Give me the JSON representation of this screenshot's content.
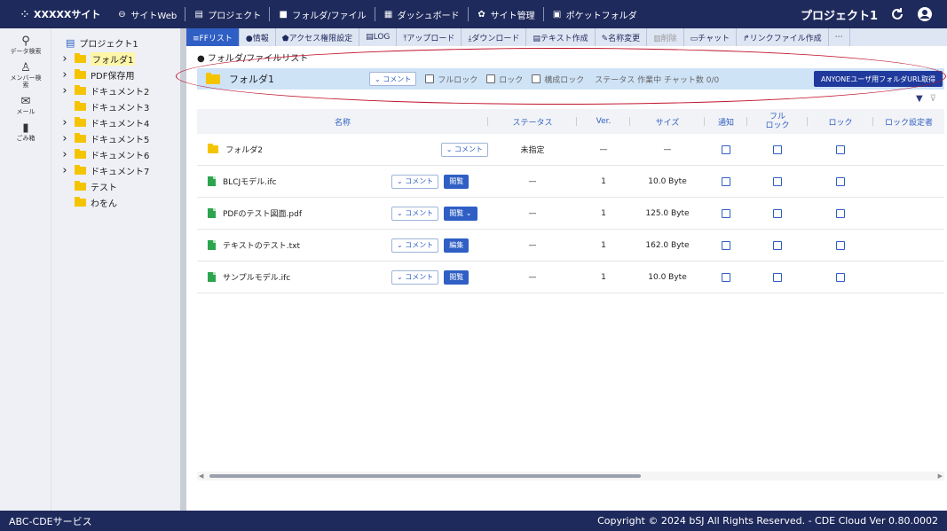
{
  "topbar": {
    "brand": "XXXXXサイト",
    "items": [
      {
        "icon": "link-icon",
        "glyph": "⊖",
        "label": "サイトWeb"
      },
      {
        "icon": "project-icon",
        "glyph": "▤",
        "label": "プロジェクト"
      },
      {
        "icon": "folder-icon",
        "glyph": "■",
        "label": "フォルダ/ファイル"
      },
      {
        "icon": "dashboard-icon",
        "glyph": "▦",
        "label": "ダッシュボード"
      },
      {
        "icon": "gear-icon",
        "glyph": "✿",
        "label": "サイト管理"
      },
      {
        "icon": "pocket-folder-icon",
        "glyph": "▣",
        "label": "ポケットフォルダ"
      }
    ],
    "project_name": "プロジェクト1"
  },
  "rail": [
    {
      "icon": "data-search-icon",
      "glyph": "⚲",
      "label": "データ検索"
    },
    {
      "icon": "member-search-icon",
      "glyph": "♙",
      "label": "メンバー検索"
    },
    {
      "icon": "mail-icon",
      "glyph": "✉",
      "label": "メール"
    },
    {
      "icon": "trash-icon",
      "glyph": "▮",
      "label": "ごみ箱"
    }
  ],
  "tree": {
    "root": "プロジェクト1",
    "nodes": [
      {
        "label": "フォルダ1",
        "chevron": true,
        "selected": true
      },
      {
        "label": "PDF保存用",
        "chevron": true,
        "selected": false
      },
      {
        "label": "ドキュメント2",
        "chevron": true,
        "selected": false
      },
      {
        "label": "ドキュメント3",
        "chevron": false,
        "selected": false
      },
      {
        "label": "ドキュメント4",
        "chevron": true,
        "selected": false
      },
      {
        "label": "ドキュメント5",
        "chevron": true,
        "selected": false
      },
      {
        "label": "ドキュメント6",
        "chevron": true,
        "selected": false
      },
      {
        "label": "ドキュメント7",
        "chevron": true,
        "selected": false
      },
      {
        "label": "テスト",
        "chevron": false,
        "selected": false
      },
      {
        "label": "わをん",
        "chevron": false,
        "selected": false
      }
    ]
  },
  "toolbar": [
    {
      "label": "≡FFリスト",
      "state": "active"
    },
    {
      "label": "●情報",
      "state": "normal"
    },
    {
      "label": "⬟アクセス権限設定",
      "state": "normal"
    },
    {
      "label": "▤LOG",
      "state": "normal"
    },
    {
      "label": "⤒アップロード",
      "state": "normal"
    },
    {
      "label": "⤓ダウンロード",
      "state": "normal"
    },
    {
      "label": "▤テキスト作成",
      "state": "normal"
    },
    {
      "label": "✎名称変更",
      "state": "normal"
    },
    {
      "label": "▥削除",
      "state": "disabled"
    },
    {
      "label": "▭チャット",
      "state": "normal"
    },
    {
      "label": "↱リンクファイル作成",
      "state": "normal"
    },
    {
      "label": "⋯",
      "state": "normal"
    }
  ],
  "breadcrumb": "● フォルダ/ファイルリスト",
  "folderbar": {
    "name": "フォルダ1",
    "comment": "⌄ コメント",
    "options": [
      "フルロック",
      "ロック",
      "構成ロック"
    ],
    "status": "ステータス 作業中  チャット数 0/0",
    "anyone_button": "ANYONEユーザ用フォルダURL取得"
  },
  "filters": {
    "funnel": "▼",
    "clear": "⊽"
  },
  "table": {
    "headers": {
      "name": "名称",
      "status": "ステータス",
      "ver": "Ver.",
      "size": "サイズ",
      "notify": "通知",
      "fulllock": "フル\nロック",
      "lock": "ロック",
      "locker": "ロック設定者"
    },
    "rows": [
      {
        "kind": "folder",
        "name": "フォルダ2",
        "comment": "⌄ コメント",
        "action": "",
        "status": "未指定",
        "ver": "—",
        "size": "—"
      },
      {
        "kind": "file",
        "name": "BLCJモデル.ifc",
        "comment": "⌄ コメント",
        "action": "閲覧",
        "status": "—",
        "ver": "1",
        "size": "10.0 Byte"
      },
      {
        "kind": "file",
        "name": "PDFのテスト図面.pdf",
        "comment": "⌄ コメント",
        "action": "閲覧  ⌄",
        "status": "—",
        "ver": "1",
        "size": "125.0 Byte"
      },
      {
        "kind": "file",
        "name": "テキストのテスト.txt",
        "comment": "⌄ コメント",
        "action": "編集",
        "status": "—",
        "ver": "1",
        "size": "162.0 Byte"
      },
      {
        "kind": "file",
        "name": "サンプルモデル.ifc",
        "comment": "⌄ コメント",
        "action": "閲覧",
        "status": "—",
        "ver": "1",
        "size": "10.0 Byte"
      }
    ]
  },
  "footer": {
    "left": "ABC-CDEサービス",
    "right": "Copyright © 2024 bSJ All Rights Reserved. - CDE Cloud Ver 0.80.0002"
  }
}
